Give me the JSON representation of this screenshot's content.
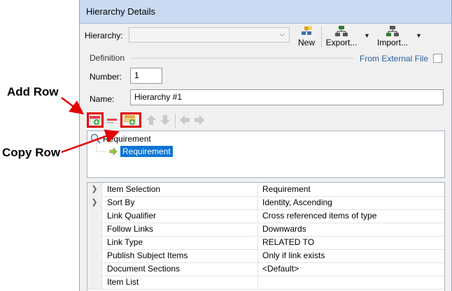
{
  "callouts": {
    "add_row": "Add Row",
    "copy_row": "Copy Row"
  },
  "window": {
    "title": "Hierarchy Details"
  },
  "hierarchy_bar": {
    "label": "Hierarchy:",
    "value": "",
    "new_label": "New",
    "export_label": "Export...",
    "import_label": "Import..."
  },
  "definition": {
    "group_title": "Definition",
    "from_external_label": "From External File",
    "from_external_checked": false,
    "number_label": "Number:",
    "number_value": "1",
    "name_label": "Name:",
    "name_value": "Hierarchy #1"
  },
  "tree": {
    "root_label": "Requirement",
    "child_label": "Requirement"
  },
  "properties": [
    {
      "key": "Item Selection",
      "value": "Requirement",
      "expandable": true
    },
    {
      "key": "Sort By",
      "value": "Identity, Ascending",
      "expandable": true
    },
    {
      "key": "Link Qualifier",
      "value": "Cross referenced items of type",
      "expandable": false
    },
    {
      "key": "Follow Links",
      "value": "Downwards",
      "expandable": false
    },
    {
      "key": "Link Type",
      "value": "RELATED TO",
      "expandable": false
    },
    {
      "key": "Publish Subject Items",
      "value": "Only if link exists",
      "expandable": false
    },
    {
      "key": "Document Sections",
      "value": "<Default>",
      "expandable": false
    },
    {
      "key": "Item List",
      "value": "",
      "expandable": false
    }
  ],
  "colors": {
    "callout_red": "#e30000",
    "selection_blue": "#0a74d6",
    "title_bar": "#c9daf2"
  }
}
